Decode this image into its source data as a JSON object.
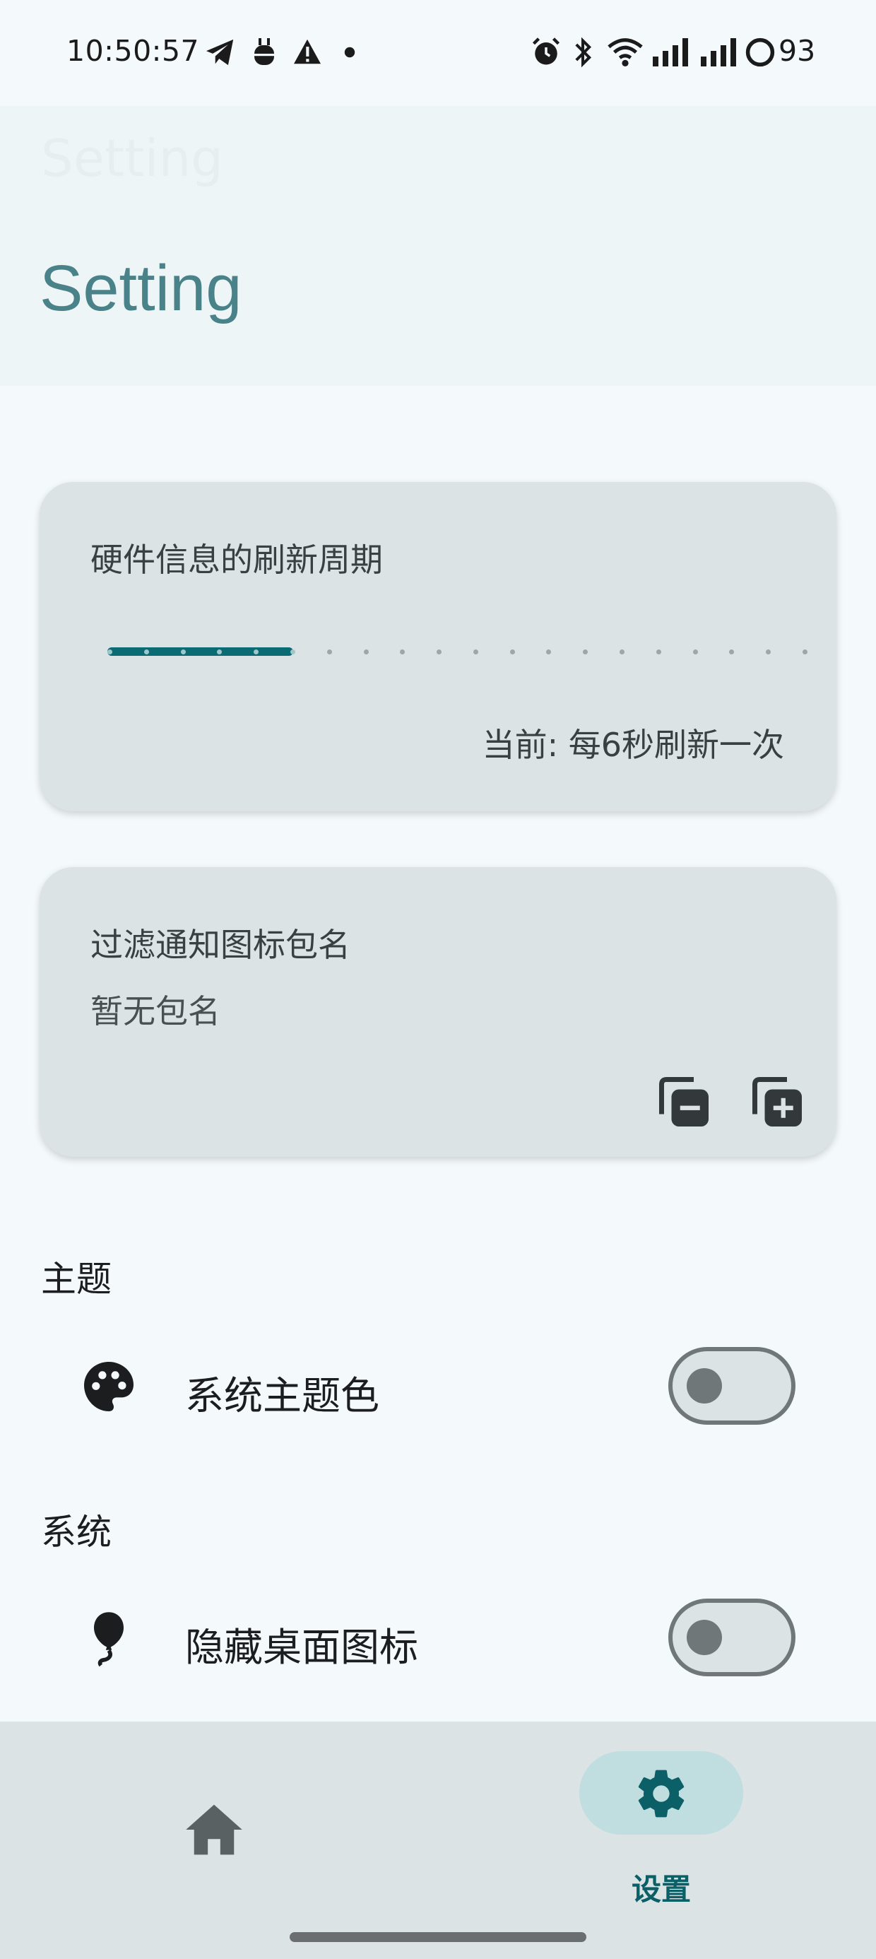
{
  "status_bar": {
    "time": "10:50:57",
    "left_icons": [
      "telegram-icon",
      "android-debug-icon",
      "warning-icon",
      "dot-icon"
    ],
    "right_icons": [
      "alarm-icon",
      "bluetooth-icon",
      "wifi-icon",
      "signal-icon",
      "signal-icon",
      "battery-ring-icon"
    ],
    "battery": "93"
  },
  "header": {
    "collapsed_title": "Setting",
    "title": "Setting"
  },
  "refresh_card": {
    "title": "硬件信息的刷新周期",
    "slider": {
      "steps": 20,
      "value_index": 5,
      "accent": "#0b6b72"
    },
    "current": "当前: 每6秒刷新一次"
  },
  "filter_card": {
    "title": "过滤通知图标包名",
    "value": "暂无包名",
    "actions": [
      "remove-package-icon",
      "add-package-icon"
    ]
  },
  "sections": {
    "theme": {
      "title": "主题",
      "item_label": "系统主题色",
      "item_icon": "palette-icon",
      "enabled": false
    },
    "system": {
      "title": "系统",
      "item_label": "隐藏桌面图标",
      "item_icon": "balloon-icon",
      "enabled": false
    }
  },
  "bottom_nav": {
    "home_icon": "home-icon",
    "settings_icon": "gear-icon",
    "settings_label": "设置",
    "selected": "settings"
  },
  "colors": {
    "background": "#f4f9fb",
    "card": "#dbe3e5",
    "accent": "#0b6b72",
    "title": "#4a8289",
    "pill": "#c0dde0"
  }
}
